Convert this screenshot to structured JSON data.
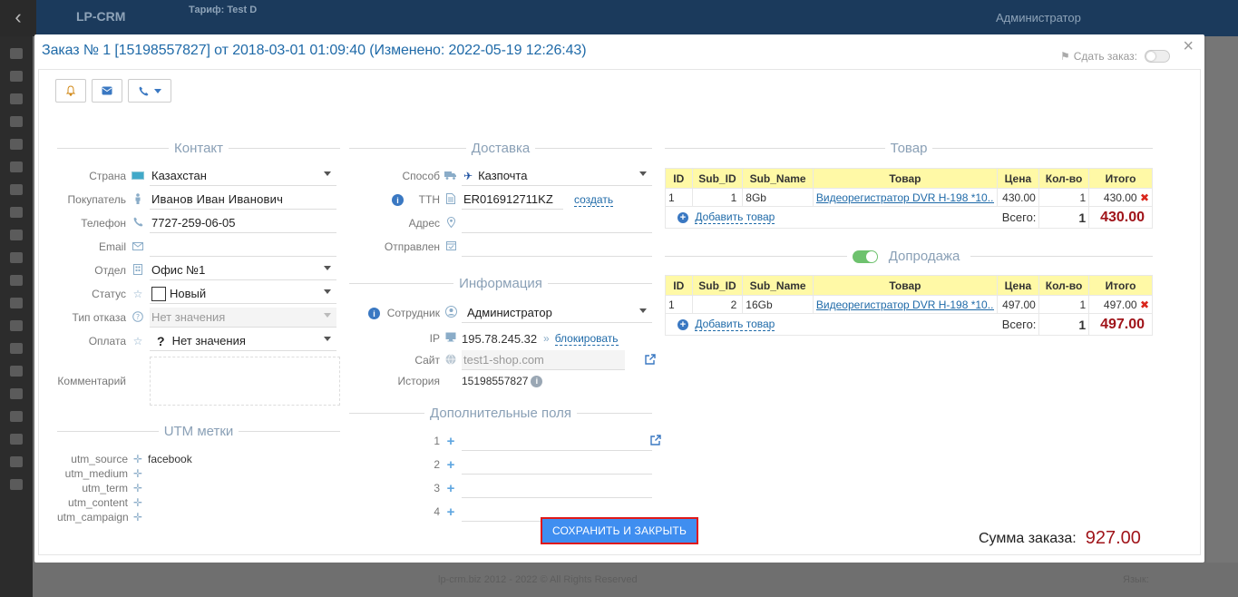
{
  "background": {
    "logo": "LP-CRM",
    "tariff": "Тариф: Test D",
    "admin": "Администратор",
    "footer": "lp-crm.biz 2012 - 2022 © All Rights Reserved",
    "lang": "Язык:"
  },
  "modal": {
    "title": "Заказ № 1 [15198557827] от 2018-03-01 01:09:40 (Изменено: 2022-05-19 12:26:43)",
    "sdat_label": "Сдать заказ:",
    "close": "×"
  },
  "contact": {
    "section": "Контакт",
    "country_label": "Страна",
    "country": "Казахстан",
    "buyer_label": "Покупатель",
    "buyer": "Иванов Иван Иванович",
    "phone_label": "Телефон",
    "phone": "7727-259-06-05",
    "email_label": "Email",
    "email": "",
    "dept_label": "Отдел",
    "dept": "Офис №1",
    "status_label": "Статус",
    "status": "Новый",
    "refusal_label": "Тип отказа",
    "refusal": "Нет значения",
    "payment_label": "Оплата",
    "payment": "Нет значения",
    "comment_label": "Комментарий"
  },
  "utm": {
    "section": "UTM метки",
    "rows": [
      {
        "label": "utm_source",
        "value": "facebook"
      },
      {
        "label": "utm_medium",
        "value": ""
      },
      {
        "label": "utm_term",
        "value": ""
      },
      {
        "label": "utm_content",
        "value": ""
      },
      {
        "label": "utm_campaign",
        "value": ""
      }
    ]
  },
  "delivery": {
    "section": "Доставка",
    "method_label": "Способ",
    "method": "Казпочта",
    "ttn_label": "ТТН",
    "ttn": "ER016912711KZ",
    "ttn_create": "создать",
    "address_label": "Адрес",
    "sent_label": "Отправлен"
  },
  "info": {
    "section": "Информация",
    "employee_label": "Сотрудник",
    "employee": "Администратор",
    "ip_label": "IP",
    "ip": "195.78.245.32",
    "block": "блокировать",
    "site_label": "Сайт",
    "site": "test1-shop.com",
    "history_label": "История",
    "history": "15198557827"
  },
  "extra": {
    "section": "Дополнительные поля",
    "rows": [
      "1",
      "2",
      "3",
      "4"
    ]
  },
  "goods": {
    "section": "Товар",
    "headers": [
      "ID",
      "Sub_ID",
      "Sub_Name",
      "Товар",
      "Цена",
      "Кол-во",
      "Итого"
    ],
    "rows": [
      {
        "id": "1",
        "sub_id": "1",
        "sub_name": "8Gb",
        "product": "Видеорегистратор DVR H-198 *10...",
        "price": "430.00",
        "qty": "1",
        "total": "430.00"
      }
    ],
    "add": "Добавить товар",
    "sum_label": "Всего:",
    "sum_qty": "1",
    "sum_total": "430.00"
  },
  "upsell": {
    "section": "Допродажа",
    "headers": [
      "ID",
      "Sub_ID",
      "Sub_Name",
      "Товар",
      "Цена",
      "Кол-во",
      "Итого"
    ],
    "rows": [
      {
        "id": "1",
        "sub_id": "2",
        "sub_name": "16Gb",
        "product": "Видеорегистратор DVR H-198 *10...",
        "price": "497.00",
        "qty": "1",
        "total": "497.00"
      }
    ],
    "add": "Добавить товар",
    "sum_label": "Всего:",
    "sum_qty": "1",
    "sum_total": "497.00"
  },
  "order_sum": {
    "label": "Сумма заказа:",
    "value": "927.00"
  },
  "save_button": "СОХРАНИТЬ И ЗАКРЫТЬ",
  "colors": {
    "accent": "#1f6aa8",
    "save": "#3f8ef0",
    "highlight": "#e01919",
    "total": "#a0141a",
    "header_bg": "#fff9a6",
    "toggle_on": "#6ec26e"
  }
}
